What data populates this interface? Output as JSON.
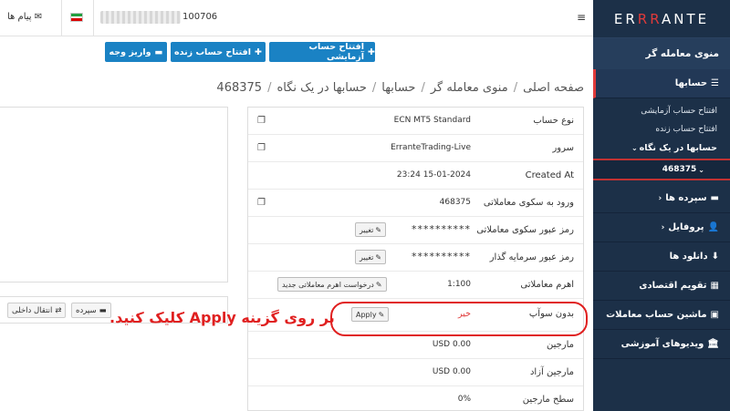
{
  "sidebar": {
    "logo": "ERRANTE",
    "title": "منوی معامله گر",
    "accounts_label": "حسابها",
    "sub_items": [
      "افتتاح حساب آزمایشی",
      "افتتاح حساب زنده"
    ],
    "at_a_glance": "حسابها در یک نگاه",
    "account_number": "468375",
    "items": [
      {
        "label": "سپرده ها",
        "icon": "wallet-icon"
      },
      {
        "label": "پروفایل",
        "icon": "user-icon"
      },
      {
        "label": "دانلود ها",
        "icon": "download-icon"
      },
      {
        "label": "تقویم اقتصادی",
        "icon": "calendar-icon"
      },
      {
        "label": "ماشین حساب معاملات",
        "icon": "calculator-icon"
      },
      {
        "label": "ویدیوهای آموزشی",
        "icon": "bank-icon"
      }
    ]
  },
  "topbar": {
    "account_id": "100706",
    "messages_label": "پیام ها"
  },
  "actions": {
    "demo": "افتتاح حساب آزمایشی",
    "live": "افتتاح حساب زنده",
    "deposit": "واریز وجه"
  },
  "breadcrumb": [
    "صفحه اصلی",
    "منوی معامله گر",
    "حسابها",
    "حسابها در یک نگاه",
    "468375"
  ],
  "left_actions": {
    "deposit": "سپرده",
    "internal_transfer": "انتقال داخلی"
  },
  "details": [
    {
      "label": "نوع حساب",
      "value": "ECN MT5 Standard",
      "copy": true
    },
    {
      "label": "سرور",
      "value": "ErranteTrading-Live",
      "copy": true
    },
    {
      "label": "Created At",
      "value": "23:24 15-01-2024"
    },
    {
      "label": "ورود به سکوی معاملاتی",
      "value": "468375",
      "copy": true
    },
    {
      "label": "رمز عبور سکوی معاملاتی",
      "value": "**********",
      "action": "تغییر"
    },
    {
      "label": "رمز عبور سرمایه گذار",
      "value": "**********",
      "action": "تغییر"
    },
    {
      "label": "اهرم معاملاتی",
      "value": "1:100",
      "action": "درخواست اهرم معاملاتی جدید"
    },
    {
      "label": "بدون سوآپ",
      "value": "خیر",
      "action": "Apply"
    },
    {
      "label": "مارجین",
      "value": "USD 0.00"
    },
    {
      "label": "مارجین آزاد",
      "value": "USD 0.00"
    },
    {
      "label": "سطح مارجین",
      "value": "0%"
    }
  ],
  "callout": "بر روی گزینه Apply کلیک کنید."
}
